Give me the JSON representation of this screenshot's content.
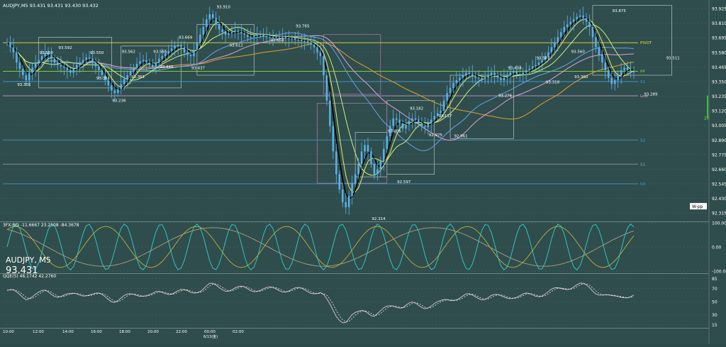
{
  "header": {
    "title": "AUDJPY,M5 93.431 93.431 93.430 93.432"
  },
  "instrument": {
    "symbol": "AUDJPY, M5",
    "last_price": "93.431"
  },
  "indicators": {
    "rci_label": "3FX-RCI -11.6667 23.2508 -84.3678",
    "rsi_label": "QQE(5) 46.1742 42.2760"
  },
  "colors": {
    "background": "#2f4d4c",
    "grid": "#4e6a69",
    "candle": "#5ab4f0",
    "black_ma": "#000000",
    "yellow_ma": "#e8f060",
    "pale_green_ma": "#c8f080",
    "blue_ma": "#6aa0e8",
    "pink_ma": "#e0a0e0",
    "orange_ma": "#e0a030",
    "cyan": "#30d0d0",
    "olive": "#c0b040"
  },
  "chart_data": [
    {
      "type": "line",
      "title": "",
      "series_kind": "candlestick",
      "x_ticks": [
        "10:00",
        "12:00",
        "14:00",
        "16:00",
        "18:00",
        "20:00",
        "22:00",
        "00:00",
        "02:00"
      ],
      "date_label": "6/13(金)",
      "y_ticks": [
        92.315,
        92.43,
        92.545,
        92.66,
        92.775,
        92.89,
        93.005,
        93.12,
        93.235,
        93.35,
        93.465,
        93.58,
        93.695,
        93.81,
        93.925
      ],
      "ylim": [
        92.26,
        93.97
      ],
      "price_labels": [
        {
          "value": "93.305",
          "x": 5,
          "y": 93.3
        },
        {
          "value": "93.550",
          "x": 12,
          "y": 93.55
        },
        {
          "value": "93.592",
          "x": 18,
          "y": 93.59
        },
        {
          "value": "93.550",
          "x": 28,
          "y": 93.55
        },
        {
          "value": "93.351",
          "x": 30,
          "y": 93.35
        },
        {
          "value": "93.238",
          "x": 35,
          "y": 93.24
        },
        {
          "value": "93.562",
          "x": 38,
          "y": 93.56
        },
        {
          "value": "93.361",
          "x": 41,
          "y": 93.36
        },
        {
          "value": "93.565",
          "x": 48,
          "y": 93.56
        },
        {
          "value": "93.445",
          "x": 50,
          "y": 93.44
        },
        {
          "value": "93.669",
          "x": 56,
          "y": 93.67
        },
        {
          "value": "93.437",
          "x": 60,
          "y": 93.43
        },
        {
          "value": "93.910",
          "x": 68,
          "y": 93.91
        },
        {
          "value": "93.612",
          "x": 72,
          "y": 93.61
        },
        {
          "value": "93.765",
          "x": 93,
          "y": 93.76
        },
        {
          "value": "93.658",
          "x": 85,
          "y": 93.65
        },
        {
          "value": "92.314",
          "x": 117,
          "y": 92.31
        },
        {
          "value": "93.005",
          "x": 122,
          "y": 93.0
        },
        {
          "value": "92.597",
          "x": 125,
          "y": 92.6
        },
        {
          "value": "93.182",
          "x": 129,
          "y": 93.18
        },
        {
          "value": "92.975",
          "x": 135,
          "y": 92.97
        },
        {
          "value": "93.117",
          "x": 138,
          "y": 93.12
        },
        {
          "value": "92.961",
          "x": 143,
          "y": 92.96
        },
        {
          "value": "93.434",
          "x": 160,
          "y": 93.43
        },
        {
          "value": "93.276",
          "x": 157,
          "y": 93.28
        },
        {
          "value": "93.507",
          "x": 169,
          "y": 93.51
        },
        {
          "value": "93.318",
          "x": 172,
          "y": 93.32
        },
        {
          "value": "93.560",
          "x": 180,
          "y": 93.56
        },
        {
          "value": "93.360",
          "x": 181,
          "y": 93.36
        },
        {
          "value": "93.875",
          "x": 193,
          "y": 93.88
        },
        {
          "value": "93.289",
          "x": 203,
          "y": 93.29
        },
        {
          "value": "93.511",
          "x": 210,
          "y": 93.51
        }
      ],
      "levels": [
        {
          "label": "PIVOT",
          "value": 93.656,
          "color": "#e8e040"
        },
        {
          "label": "PP",
          "value": 93.431,
          "color": "#80e040"
        },
        {
          "label": "S1",
          "value": 93.35,
          "color": "#40a0e0"
        },
        {
          "label": "Low",
          "value": 93.238,
          "color": "#e0a0e0"
        },
        {
          "label": "S2",
          "value": 92.89,
          "color": "#40a0e0"
        },
        {
          "label": "S1",
          "value": 92.7,
          "color": "#a0a0a0"
        },
        {
          "label": "S3",
          "value": 92.545,
          "color": "#40a0e0"
        }
      ],
      "right_badges": [
        "93.810",
        "93.695",
        "93.656",
        "93.580",
        "93.465",
        "93.431",
        "93.350",
        "93.238",
        "93.120",
        "92.890",
        "92.775",
        "92.660",
        "92.545",
        "92.430",
        "92.315"
      ],
      "side_tag": "20",
      "corner_tag": "W-pp",
      "candles_close": [
        93.66,
        93.62,
        93.58,
        93.5,
        93.45,
        93.4,
        93.36,
        93.42,
        93.46,
        93.5,
        93.52,
        93.55,
        93.58,
        93.56,
        93.53,
        93.5,
        93.48,
        93.47,
        93.46,
        93.44,
        93.42,
        93.45,
        93.48,
        93.5,
        93.52,
        93.54,
        93.53,
        93.5,
        93.47,
        93.44,
        93.4,
        93.36,
        93.32,
        93.28,
        93.26,
        93.29,
        93.33,
        93.37,
        93.4,
        93.43,
        93.46,
        93.49,
        93.51,
        93.52,
        93.5,
        93.48,
        93.46,
        93.5,
        93.53,
        93.55,
        93.57,
        93.59,
        93.61,
        93.63,
        93.64,
        93.62,
        93.58,
        93.56,
        93.55,
        93.6,
        93.66,
        93.72,
        93.78,
        93.84,
        93.88,
        93.85,
        93.8,
        93.76,
        93.74,
        93.72,
        93.73,
        93.74,
        93.75,
        93.74,
        93.73,
        93.72,
        93.7,
        93.7,
        93.71,
        93.72,
        93.72,
        93.71,
        93.7,
        93.7,
        93.7,
        93.7,
        93.7,
        93.7,
        93.69,
        93.69,
        93.69,
        93.68,
        93.68,
        93.67,
        93.67,
        93.66,
        93.64,
        93.62,
        93.58,
        93.55,
        93.4,
        93.2,
        93.0,
        92.8,
        92.62,
        92.5,
        92.4,
        92.36,
        92.45,
        92.55,
        92.62,
        92.7,
        92.8,
        92.85,
        92.8,
        92.7,
        92.62,
        92.66,
        92.72,
        92.82,
        92.92,
        93.0,
        93.06,
        93.05,
        93.02,
        92.98,
        93.01,
        93.04,
        93.06,
        93.05,
        93.02,
        93.0,
        92.99,
        93.02,
        93.05,
        93.08,
        93.1,
        93.12,
        93.2,
        93.26,
        93.3,
        93.34,
        93.36,
        93.38,
        93.4,
        93.42,
        93.41,
        93.39,
        93.38,
        93.38,
        93.37,
        93.38,
        93.4,
        93.42,
        93.4,
        93.38,
        93.36,
        93.38,
        93.4,
        93.42,
        93.43,
        93.41,
        93.4,
        93.42,
        93.44,
        93.45,
        93.47,
        93.48,
        93.5,
        93.52,
        93.55,
        93.58,
        93.62,
        93.66,
        93.7,
        93.74,
        93.78,
        93.8,
        93.82,
        93.84,
        93.86,
        93.87,
        93.85,
        93.82,
        93.78,
        93.7,
        93.62,
        93.56,
        93.5,
        93.44,
        93.38,
        93.33,
        93.36,
        93.4,
        93.44,
        93.46,
        93.44,
        93.43,
        93.43
      ]
    },
    {
      "type": "line",
      "title": "",
      "indicator": "RCI",
      "ylim": [
        -100,
        100
      ],
      "y_ticks": [
        100,
        0,
        -100
      ],
      "y_tick_labels": [
        "100.00",
        "0.00",
        "-100.00"
      ]
    },
    {
      "type": "line",
      "title": "",
      "indicator": "QQE",
      "ylim": [
        10,
        90
      ],
      "y_ticks": [
        85,
        70,
        50,
        30,
        15
      ],
      "y_tick_labels": [
        "85",
        "70",
        "50",
        "30",
        "15"
      ]
    }
  ]
}
